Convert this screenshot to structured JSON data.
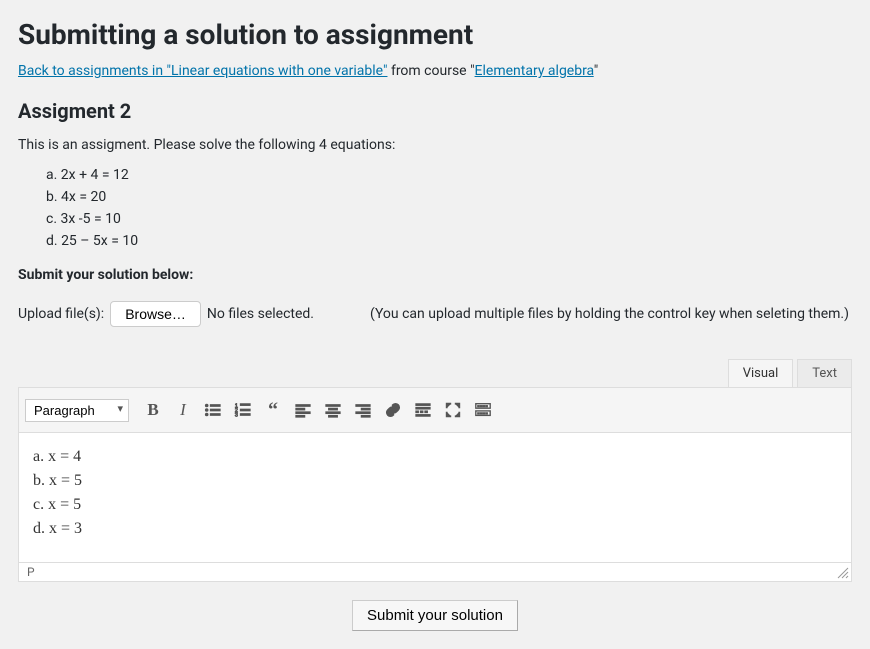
{
  "page": {
    "title": "Submitting a solution to assignment"
  },
  "breadcrumb": {
    "prefix": "",
    "back_link": "Back to assignments in \"Linear equations with one variable\"",
    "mid": " from course \"",
    "course_link": "Elementary algebra",
    "suffix": "\""
  },
  "assignment": {
    "heading": "Assigment 2",
    "description": "This is an assigment. Please solve the following 4 equations:",
    "equations": [
      "2x + 4 = 12",
      "4x = 20",
      "3x -5 = 10",
      "25 – 5x = 10"
    ]
  },
  "submit_section": {
    "label": "Submit your solution below:",
    "upload_label": "Upload file(s):",
    "browse": "Browse…",
    "no_files": "No files selected.",
    "hint": "(You can upload multiple files by holding the control key when seleting them.)"
  },
  "editor": {
    "tabs": {
      "visual": "Visual",
      "text": "Text"
    },
    "format_select": "Paragraph",
    "content_lines": [
      "a. x = 4",
      "b. x = 5",
      "c. x =  5",
      "d. x =  3"
    ],
    "path": "P"
  },
  "submit_button": "Submit your solution"
}
